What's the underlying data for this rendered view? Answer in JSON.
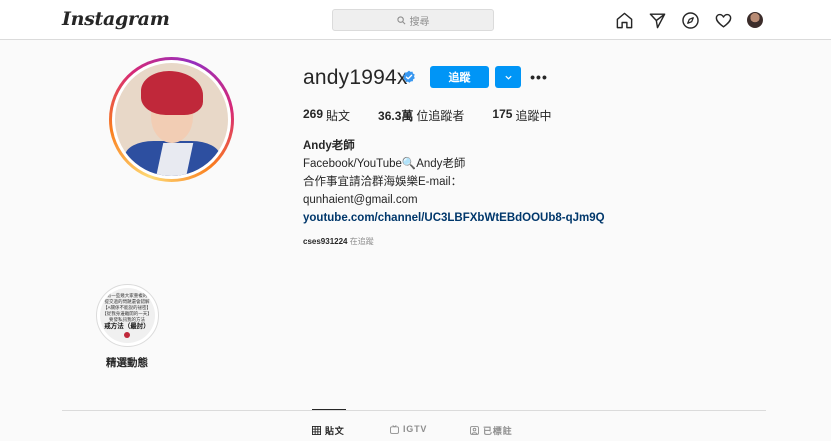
{
  "header": {
    "logo": "Instagram",
    "search_placeholder": "搜尋",
    "icons": [
      "home-icon",
      "direct-icon",
      "explore-icon",
      "activity-heart-icon",
      "profile-avatar"
    ]
  },
  "profile": {
    "username": "andy1994x",
    "verified": true,
    "follow_label": "追蹤",
    "stats": {
      "posts_count": "269",
      "posts_label": "貼文",
      "followers_count": "36.3萬",
      "followers_label": "位追蹤者",
      "following_count": "175",
      "following_label": "追蹤中"
    },
    "bio": {
      "name": "Andy老師",
      "line1": "Facebook/YouTube🔍Andy老師",
      "line2": "合作事宜請洽群海娛樂E-mail：",
      "line3": "qunhaient@gmail.com",
      "link": "youtube.com/channel/UC3LBFXbWtEBdOOUb8-qJm9Q"
    },
    "followed_by_user": "cses931224",
    "followed_by_suffix": "在追蹤"
  },
  "highlights": [
    {
      "label": "精選動態",
      "cover_lines": [
        "有一些幾大家重複的",
        "提交過的問題還會錯解",
        "【A關係不能說的祕密】",
        "【從我身邊離開的一天】",
        "要發私訊我的方法"
      ],
      "cover_big": "戒方法（最討）"
    }
  ],
  "tabs": [
    {
      "label": "貼文",
      "icon": "grid-icon",
      "active": true
    },
    {
      "label": "IGTV",
      "icon": "igtv-icon",
      "active": false
    },
    {
      "label": "已標註",
      "icon": "tagged-icon",
      "active": false
    }
  ],
  "colors": {
    "primary_blue": "#0095f6",
    "link_blue": "#00376b",
    "verified_blue": "#3897f0"
  }
}
